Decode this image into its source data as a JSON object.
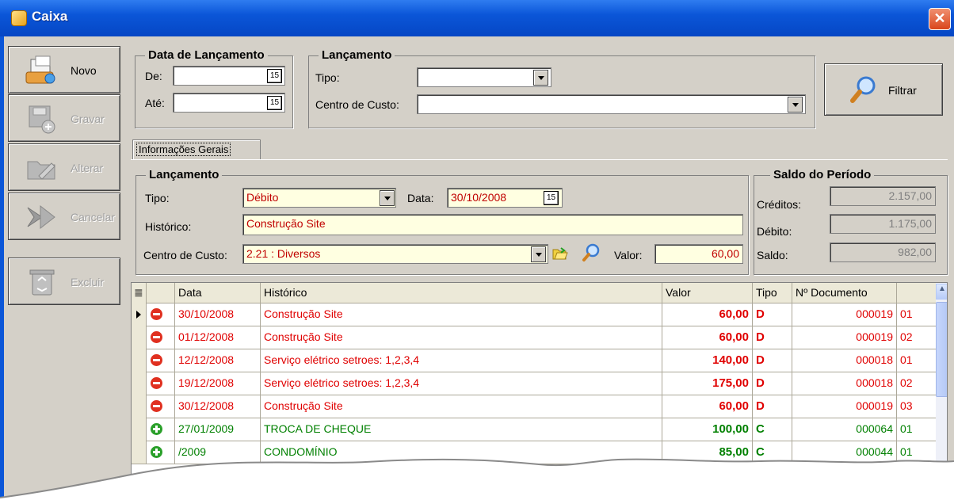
{
  "window": {
    "title": "Caixa",
    "close_label": "✕"
  },
  "sidebar": {
    "items": [
      {
        "label": "Novo",
        "enabled": true,
        "icon": "new-document-icon"
      },
      {
        "label": "Gravar",
        "enabled": false,
        "icon": "save-disk-icon"
      },
      {
        "label": "Alterar",
        "enabled": false,
        "icon": "edit-folder-icon"
      },
      {
        "label": "Cancelar",
        "enabled": false,
        "icon": "cancel-arrow-icon"
      },
      {
        "label": "Excluir",
        "enabled": false,
        "icon": "recycle-bin-icon"
      }
    ]
  },
  "filter": {
    "data_group": {
      "title": "Data de Lançamento",
      "de_label": "De:",
      "ate_label": "Até:",
      "de_value": "",
      "ate_value": ""
    },
    "lanc_group": {
      "title": "Lançamento",
      "tipo_label": "Tipo:",
      "tipo_value": "",
      "centro_label": "Centro de Custo:",
      "centro_value": ""
    },
    "filtrar_label": "Filtrar",
    "cal_icon": "15"
  },
  "tabs": [
    {
      "label": "Informações Gerais",
      "active": true
    }
  ],
  "form": {
    "group_title": "Lançamento",
    "tipo_label": "Tipo:",
    "tipo_value": "Débito",
    "data_label": "Data:",
    "data_value": "30/10/2008",
    "historico_label": "Histórico:",
    "historico_value": "Construção Site",
    "centro_label": "Centro de Custo:",
    "centro_value": "2.21 : Diversos",
    "valor_label": "Valor:",
    "valor_value": "60,00"
  },
  "saldo": {
    "title": "Saldo do Período",
    "creditos_label": "Créditos:",
    "creditos_value": "2.157,00",
    "debito_label": "Débito:",
    "debito_value": "1.175,00",
    "saldo_label": "Saldo:",
    "saldo_value": "982,00"
  },
  "grid": {
    "columns": [
      "",
      "Data",
      "Histórico",
      "Valor",
      "Tipo",
      "Nº Documento",
      ""
    ],
    "rows": [
      {
        "status": "minus",
        "data": "30/10/2008",
        "historico": "Construção Site",
        "valor": "60,00",
        "tipo": "D",
        "doc": "000019",
        "parc": "01",
        "current": true,
        "color": "#e00000"
      },
      {
        "status": "minus",
        "data": "01/12/2008",
        "historico": "Construção Site",
        "valor": "60,00",
        "tipo": "D",
        "doc": "000019",
        "parc": "02",
        "current": false,
        "color": "#e00000"
      },
      {
        "status": "minus",
        "data": "12/12/2008",
        "historico": "Serviço elétrico setroes: 1,2,3,4",
        "valor": "140,00",
        "tipo": "D",
        "doc": "000018",
        "parc": "01",
        "current": false,
        "color": "#e00000"
      },
      {
        "status": "minus",
        "data": "19/12/2008",
        "historico": "Serviço elétrico setroes: 1,2,3,4",
        "valor": "175,00",
        "tipo": "D",
        "doc": "000018",
        "parc": "02",
        "current": false,
        "color": "#e00000"
      },
      {
        "status": "minus",
        "data": "30/12/2008",
        "historico": "Construção Site",
        "valor": "60,00",
        "tipo": "D",
        "doc": "000019",
        "parc": "03",
        "current": false,
        "color": "#e00000"
      },
      {
        "status": "plus",
        "data": "27/01/2009",
        "historico": "TROCA DE CHEQUE",
        "valor": "100,00",
        "tipo": "C",
        "doc": "000064",
        "parc": "01",
        "current": false,
        "color": "#008000"
      },
      {
        "status": "plus",
        "data": "/2009",
        "historico": "CONDOMÍNIO",
        "valor": "85,00",
        "tipo": "C",
        "doc": "000044",
        "parc": "01",
        "current": false,
        "color": "#008000"
      }
    ]
  },
  "colors": {
    "titlebar": "#0b56d8",
    "debit": "#e00000",
    "credit": "#008000",
    "face": "#d4d0c8",
    "input_yellow": "#ffffe1"
  }
}
